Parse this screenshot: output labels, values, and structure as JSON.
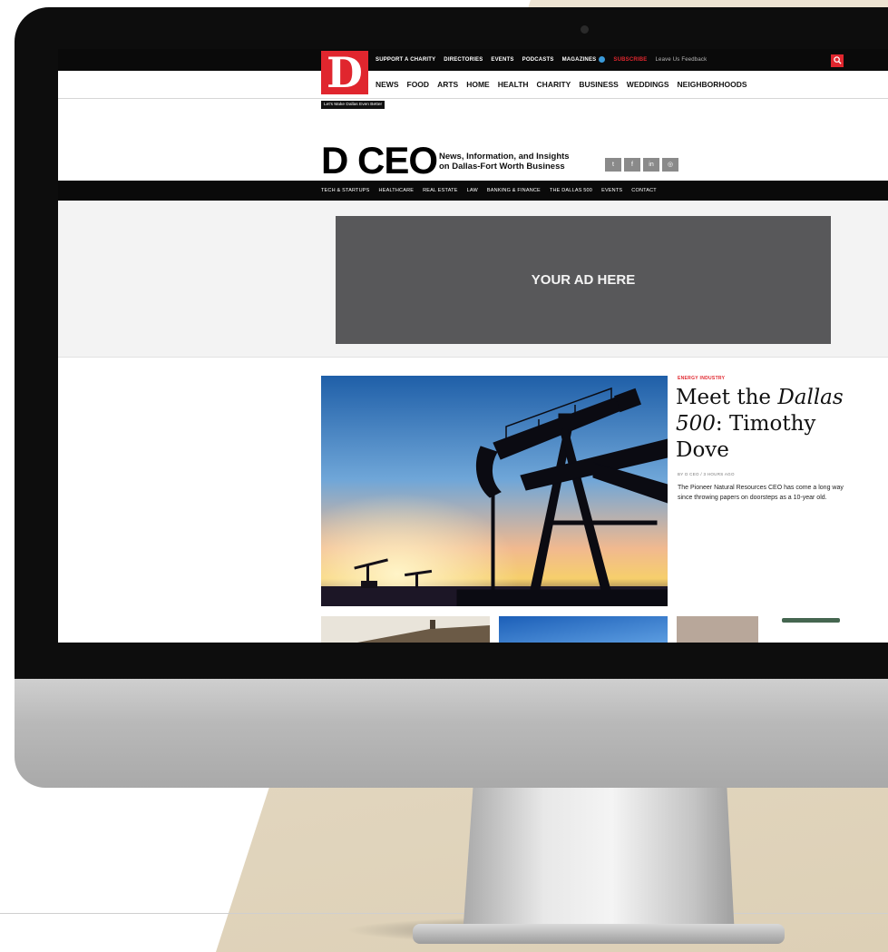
{
  "site": {
    "logo_letter": "D",
    "top_nav": {
      "links": [
        "SUPPORT A CHARITY",
        "DIRECTORIES",
        "EVENTS",
        "PODCASTS",
        "MAGAZINES"
      ],
      "subscribe": "SUBSCRIBE",
      "feedback": "Leave Us Feedback",
      "search_icon": "search-icon"
    },
    "main_nav": [
      "NEWS",
      "FOOD",
      "ARTS",
      "HOME",
      "HEALTH",
      "CHARITY",
      "BUSINESS",
      "WEDDINGS",
      "NEIGHBORHOODS"
    ],
    "tagline": "Let's Make Dallas Even Better"
  },
  "masthead": {
    "title": "D CEO",
    "tagline_line1": "News, Information, and Insights",
    "tagline_line2": "on Dallas-Fort Worth Business",
    "social_icons": [
      "twitter-icon",
      "facebook-icon",
      "linkedin-icon",
      "instagram-icon"
    ]
  },
  "sub_nav": [
    "TECH & STARTUPS",
    "HEALTHCARE",
    "REAL ESTATE",
    "LAW",
    "BANKING & FINANCE",
    "THE DALLAS 500",
    "EVENTS",
    "CONTACT"
  ],
  "ad": {
    "label": "YOUR AD HERE"
  },
  "feature": {
    "kicker": "ENERGY INDUSTRY",
    "headline_part1": "Meet the ",
    "headline_italic": "Dallas 500",
    "headline_part2": ": Timothy Dove",
    "byline": "BY D CEO / 3 HOURS AGO",
    "dek": "The Pioneer Natural Resources CEO has come a long way since throwing papers on doorsteps as a 10-year old."
  },
  "colors": {
    "brand_red": "#e0262e",
    "ad_gray": "#58585a",
    "nav_black": "#0a0a0a"
  }
}
